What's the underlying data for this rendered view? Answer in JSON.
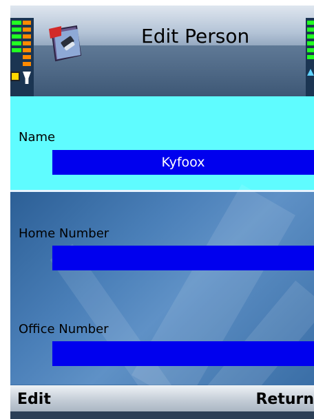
{
  "header": {
    "title": "Edit Person",
    "app_icon": "address-book-icon"
  },
  "status": {
    "signal_icon": "signal-strength-icon",
    "battery_icon": "battery-icon"
  },
  "form": {
    "fields": [
      {
        "label": "Name",
        "value": "Kyfoox",
        "selected": true
      },
      {
        "label": "Home Number",
        "value": ""
      },
      {
        "label": "Office Number",
        "value": ""
      }
    ]
  },
  "softkeys": {
    "left": "Edit",
    "right": "Return"
  },
  "colors": {
    "selected_row": "#5ffcff",
    "field_fill": "#0000ee",
    "title_text": "#000000"
  }
}
